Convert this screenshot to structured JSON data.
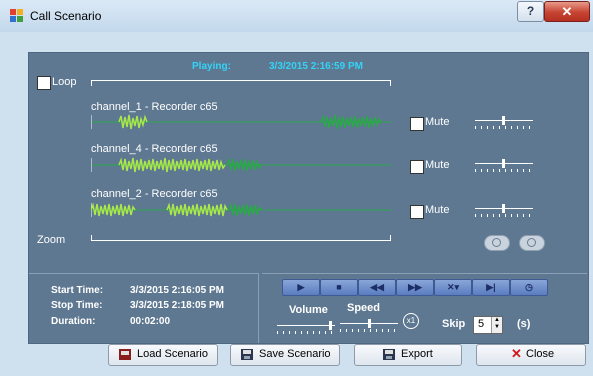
{
  "window": {
    "title": "Call Scenario",
    "help_label": "?",
    "close_label": "✕"
  },
  "player": {
    "playing_label": "Playing:",
    "playing_time": "3/3/2015 2:16:59 PM",
    "loop_label": "Loop",
    "zoom_label": "Zoom",
    "channels": [
      {
        "label": "channel_1 - Recorder c65",
        "mute_label": "Mute"
      },
      {
        "label": "channel_4 - Recorder c65",
        "mute_label": "Mute"
      },
      {
        "label": "channel_2 - Recorder c65",
        "mute_label": "Mute"
      }
    ]
  },
  "info": {
    "start_label": "Start Time:",
    "start_value": "3/3/2015 2:16:05 PM",
    "stop_label": "Stop Time:",
    "stop_value": "3/3/2015 2:18:05 PM",
    "duration_label": "Duration:",
    "duration_value": "00:02:00"
  },
  "controls": {
    "volume_label": "Volume",
    "speed_label": "Speed",
    "speed_badge": "x1",
    "skip_label": "Skip",
    "skip_value": "5",
    "skip_unit": "(s)",
    "transport": [
      {
        "name": "play-button",
        "glyph": "▶"
      },
      {
        "name": "stop-button",
        "glyph": "■"
      },
      {
        "name": "rewind-button",
        "glyph": "◀◀"
      },
      {
        "name": "fast-forward-button",
        "glyph": "▶▶"
      },
      {
        "name": "skip-options-button",
        "glyph": "✕▾"
      },
      {
        "name": "jump-to-end-button",
        "glyph": "▶|"
      },
      {
        "name": "clock-button",
        "glyph": "◷"
      }
    ]
  },
  "buttons": {
    "load": "Load Scenario",
    "save": "Save Scenario",
    "export": "Export",
    "close": "Close"
  },
  "colors": {
    "panel": "#5f7891",
    "wave_light": "#a8e84a",
    "wave_dark": "#2aa84a",
    "accent": "#33d3f7"
  }
}
